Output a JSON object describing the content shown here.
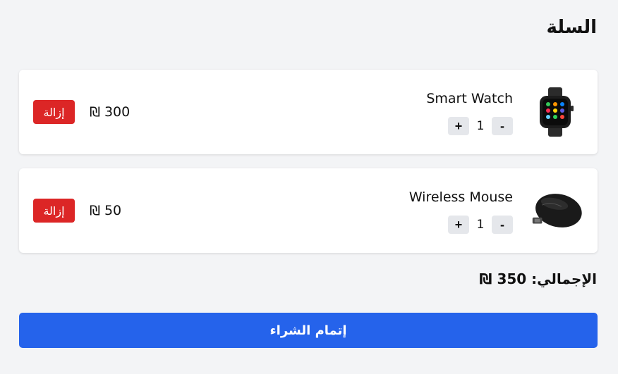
{
  "cart": {
    "title": "السلة",
    "currency_symbol": "₪",
    "items": [
      {
        "name": "Smart Watch",
        "quantity": "1",
        "price": "300 ₪",
        "remove_label": "إزالة",
        "increment_label": "+",
        "decrement_label": "-",
        "image_icon": "smartwatch-image"
      },
      {
        "name": "Wireless Mouse",
        "quantity": "1",
        "price": "50 ₪",
        "remove_label": "إزالة",
        "increment_label": "+",
        "decrement_label": "-",
        "image_icon": "wireless-mouse-image"
      }
    ],
    "total": "الإجمالي: 350 ₪",
    "checkout_label": "إتمام الشراء"
  },
  "colors": {
    "background": "#f3f4f6",
    "card": "#ffffff",
    "remove": "#dc2626",
    "checkout": "#2563eb",
    "qty_button": "#e5e7eb"
  }
}
